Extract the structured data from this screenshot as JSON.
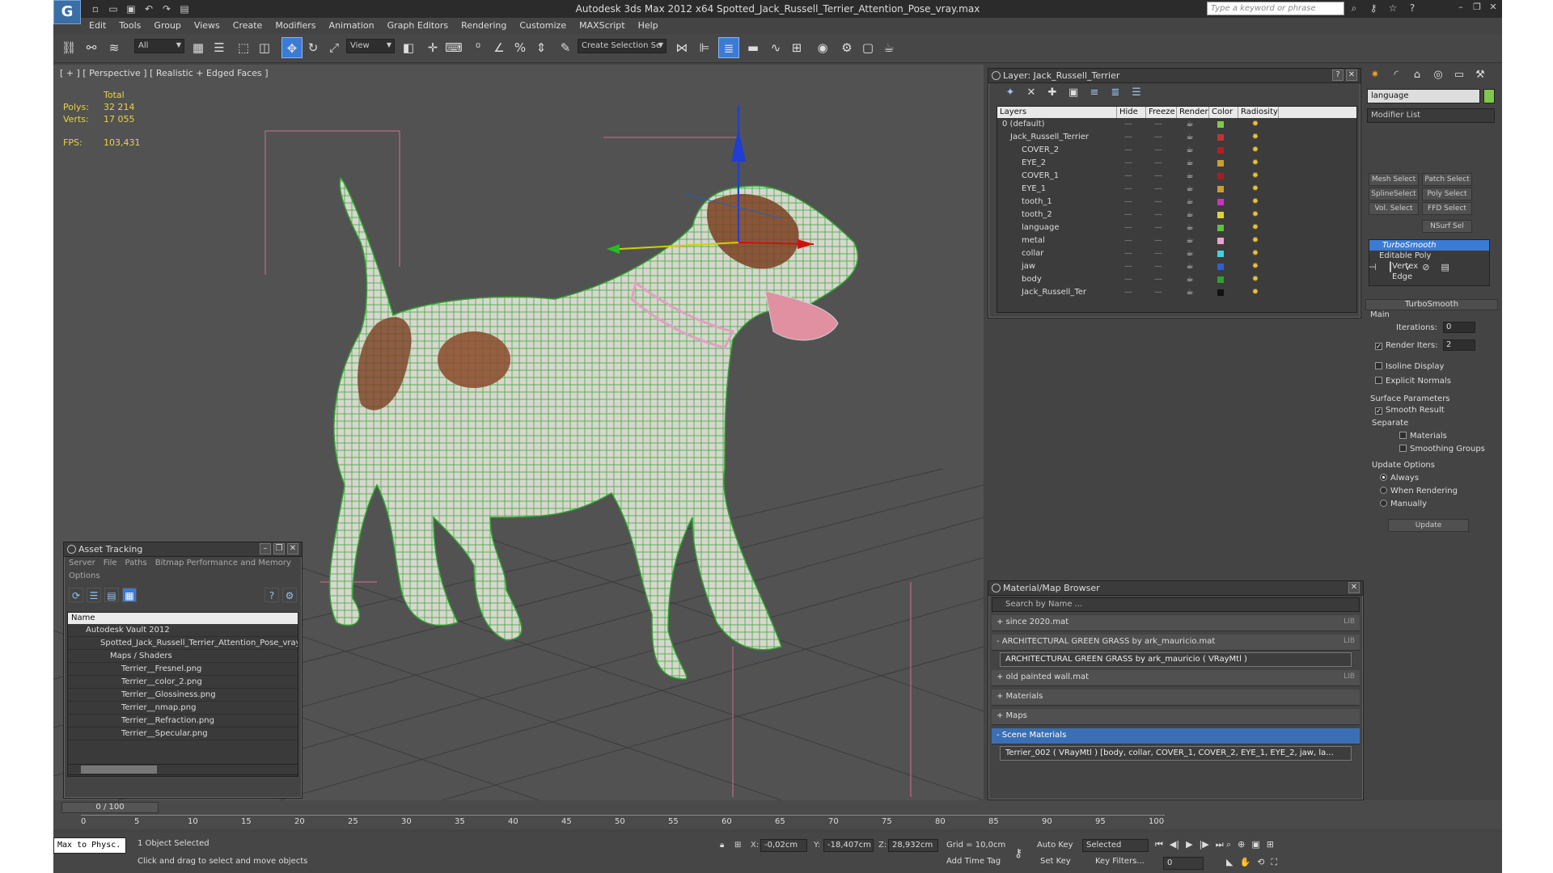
{
  "title": "Autodesk 3ds Max  2012 x64      Spotted_Jack_Russell_Terrier_Attention_Pose_vray.max",
  "search_placeholder": "Type a keyword or phrase",
  "menus": [
    "Edit",
    "Tools",
    "Group",
    "Views",
    "Create",
    "Modifiers",
    "Animation",
    "Graph Editors",
    "Rendering",
    "Customize",
    "MAXScript",
    "Help"
  ],
  "toolbar": {
    "selection_filter": "All",
    "ref_coord": "View",
    "named_sel": "Create Selection Se"
  },
  "viewport": {
    "label": "[ + ] [ Perspective ] [ Realistic + Edged Faces ]",
    "stats": {
      "total_label": "Total",
      "polys_label": "Polys:",
      "polys": "32 214",
      "verts_label": "Verts:",
      "verts": "17 055",
      "fps_label": "FPS:",
      "fps": "103,431"
    }
  },
  "layer_window": {
    "title": "Layer: Jack_Russell_Terrier",
    "columns": [
      "Layers",
      "Hide",
      "Freeze",
      "Render",
      "Color",
      "Radiosity"
    ],
    "rows": [
      {
        "name": "0 (default)",
        "color": "#7fc94a"
      },
      {
        "name": "Jack_Russell_Terrier",
        "color": "#c83030"
      },
      {
        "name": "COVER_2",
        "color": "#b02020"
      },
      {
        "name": "EYE_2",
        "color": "#c8a030"
      },
      {
        "name": "COVER_1",
        "color": "#a02020"
      },
      {
        "name": "EYE_1",
        "color": "#c8a030"
      },
      {
        "name": "tooth_1",
        "color": "#d030c0"
      },
      {
        "name": "tooth_2",
        "color": "#e0d040"
      },
      {
        "name": "language",
        "color": "#60c040"
      },
      {
        "name": "metal",
        "color": "#f0a0d0"
      },
      {
        "name": "collar",
        "color": "#40d0e0"
      },
      {
        "name": "jaw",
        "color": "#3060d0"
      },
      {
        "name": "body",
        "color": "#30a030"
      },
      {
        "name": "Jack_Russell_Ter",
        "color": "#111111"
      }
    ]
  },
  "command_panel": {
    "object_name": "language",
    "modifier_list": "Modifier List",
    "buttons": [
      "Mesh Select",
      "Patch Select",
      "SplineSelect",
      "Poly Select",
      "Vol. Select",
      "FFD Select",
      "NSurf Sel"
    ],
    "stack": [
      "TurboSmooth",
      "Editable Poly",
      "Vertex",
      "Edge"
    ],
    "turbosmooth": {
      "title": "TurboSmooth",
      "main": "Main",
      "iterations_label": "Iterations:",
      "iterations": "0",
      "render_iters_label": "Render Iters:",
      "render_iters": "2",
      "isoline": "Isoline Display",
      "explicit_normals": "Explicit Normals",
      "surface_params": "Surface Parameters",
      "smooth_result": "Smooth Result",
      "separate": "Separate",
      "materials": "Materials",
      "smoothing_groups": "Smoothing Groups",
      "update_options": "Update Options",
      "always": "Always",
      "when_rendering": "When Rendering",
      "manually": "Manually",
      "update": "Update"
    }
  },
  "material_browser": {
    "title": "Material/Map Browser",
    "search": "Search by Name ...",
    "groups": [
      {
        "label": "+ since 2020.mat",
        "lib": "LIB"
      },
      {
        "label": "- ARCHITECTURAL GREEN GRASS by ark_mauricio.mat",
        "lib": "LIB"
      }
    ],
    "grass_entry": "ARCHITECTURAL GREEN GRASS by ark_mauricio  ( VRayMtl )",
    "groups2": [
      {
        "label": "+ old painted wall.mat",
        "lib": "LIB"
      },
      {
        "label": "+ Materials",
        "lib": ""
      },
      {
        "label": "+ Maps",
        "lib": ""
      },
      {
        "label": "- Scene Materials",
        "lib": ""
      }
    ],
    "scene_entry": "Terrier_002  ( VRayMtl )  [body, collar, COVER_1, COVER_2, EYE_1, EYE_2, jaw, la..."
  },
  "asset_tracking": {
    "title": "Asset Tracking",
    "menus": [
      "Server",
      "File",
      "Paths",
      "Bitmap Performance and Memory"
    ],
    "options": "Options",
    "column": "Name",
    "rows": [
      "Autodesk Vault 2012",
      "Spotted_Jack_Russell_Terrier_Attention_Pose_vray",
      "Maps / Shaders",
      "Terrier__Fresnel.png",
      "Terrier__color_2.png",
      "Terrier__Glossiness.png",
      "Terrier__nmap.png",
      "Terrier__Refraction.png",
      "Terrier__Specular.png"
    ]
  },
  "timeline": {
    "frame": "0 / 100",
    "ticks": [
      "0",
      "5",
      "10",
      "15",
      "20",
      "25",
      "30",
      "35",
      "40",
      "45",
      "50",
      "55",
      "60",
      "65",
      "70",
      "75",
      "80",
      "85",
      "90",
      "95",
      "100"
    ]
  },
  "status": {
    "maxscript": "Max to Physc.",
    "selected": "1 Object Selected",
    "prompt": "Click and drag to select and move objects",
    "x_label": "X:",
    "x": "-0,02cm",
    "y_label": "Y:",
    "y": "-18,407cm",
    "z_label": "Z:",
    "z": "28,932cm",
    "grid": "Grid = 10,0cm",
    "add_time_tag": "Add Time Tag",
    "auto_key": "Auto Key",
    "set_key": "Set Key",
    "selected_mode": "Selected",
    "key_filters": "Key Filters...",
    "frame_field": "0"
  }
}
